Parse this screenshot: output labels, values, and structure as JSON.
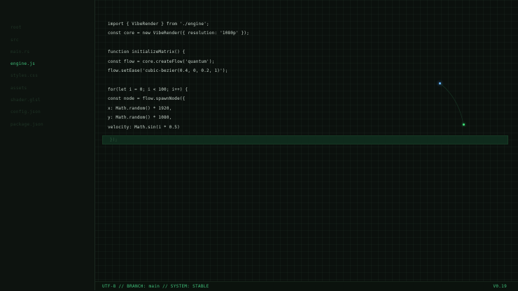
{
  "sidebar": {
    "items": [
      {
        "label": "root"
      },
      {
        "label": "src"
      },
      {
        "label": "main.rs"
      },
      {
        "label": "engine.js"
      },
      {
        "label": "styles.css"
      },
      {
        "label": "assets"
      },
      {
        "label": "shader.glsl"
      },
      {
        "label": "config.json"
      },
      {
        "label": "package.json"
      }
    ],
    "active_index": 3
  },
  "editor": {
    "lines": [
      "import { VibeRender } from './engine';",
      "const core = new VibeRender({ resolution: '1080p' });",
      "function initializeMatrix() {",
      "const flow = core.createFlow('quantum');",
      "flow.setEase('cubic-bezier(0.4, 0, 0.2, 1)');",
      "for(let i = 0; i < 100; i++) {",
      "const node = flow.spawnNode({",
      "x: Math.random() * 1920,",
      "y: Math.random() * 1080,",
      "velocity: Math.sin(i * 0.5)"
    ],
    "cursor_line": "});"
  },
  "statusbar": {
    "left": "UTF-8 // BRANCH: main // SYSTEM: STABLE",
    "right": "V0.19"
  },
  "colors": {
    "accent": "#3fc07a",
    "background": "#0b100d",
    "node_blue": "#6ab8ff",
    "node_green": "#3fe07a"
  }
}
